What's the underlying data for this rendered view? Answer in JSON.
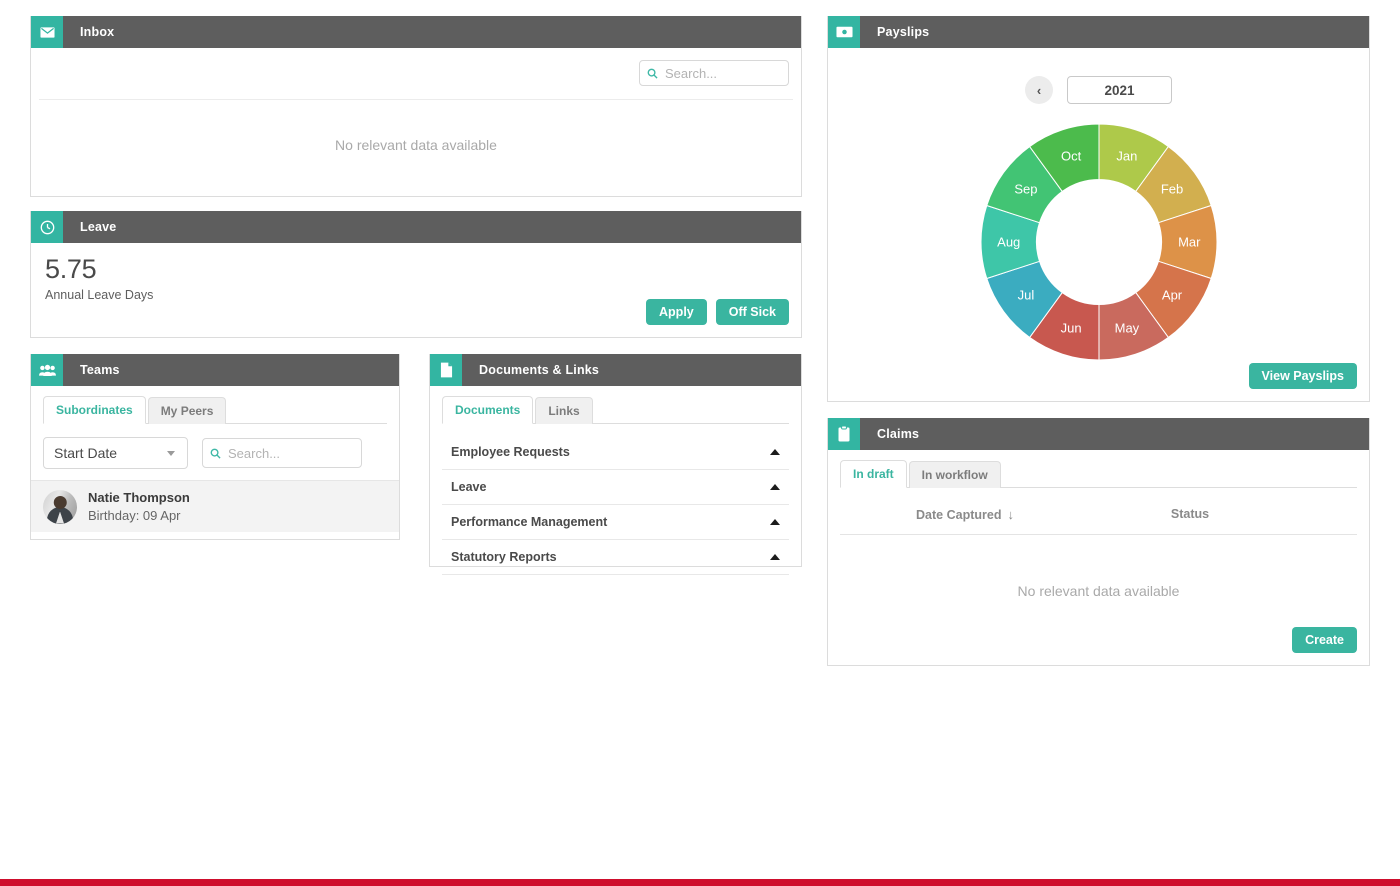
{
  "inbox": {
    "title": "Inbox",
    "icon": "envelope-icon",
    "search_placeholder": "Search...",
    "search_value": "",
    "empty_text": "No relevant data available"
  },
  "leave": {
    "title": "Leave",
    "icon": "clock-icon",
    "balance": "5.75",
    "balance_label": "Annual Leave Days",
    "apply_label": "Apply",
    "off_sick_label": "Off Sick"
  },
  "teams": {
    "title": "Teams",
    "icon": "people-icon",
    "tabs": [
      {
        "label": "Subordinates",
        "active": true
      },
      {
        "label": "My Peers",
        "active": false
      }
    ],
    "sort_value": "Start Date",
    "search_placeholder": "Search...",
    "search_value": "",
    "members": [
      {
        "name": "Natie Thompson",
        "detail": "Birthday: 09 Apr"
      }
    ]
  },
  "documents": {
    "title": "Documents & Links",
    "icon": "document-icon",
    "tabs": [
      {
        "label": "Documents",
        "active": true
      },
      {
        "label": "Links",
        "active": false
      }
    ],
    "categories": [
      {
        "label": "Employee Requests",
        "expanded": true
      },
      {
        "label": "Leave",
        "expanded": true
      },
      {
        "label": "Performance Management",
        "expanded": true
      },
      {
        "label": "Statutory Reports",
        "expanded": true
      }
    ]
  },
  "payslips": {
    "title": "Payslips",
    "icon": "money-icon",
    "prev_label": "‹",
    "year": "2021",
    "view_label": "View Payslips"
  },
  "claims": {
    "title": "Claims",
    "icon": "clipboard-icon",
    "tabs": [
      {
        "label": "In draft",
        "active": true
      },
      {
        "label": "In workflow",
        "active": false
      }
    ],
    "columns": [
      "Date Captured",
      "Status"
    ],
    "sort_indicator": "↓",
    "empty_text": "No relevant data available",
    "create_label": "Create",
    "rows": []
  },
  "chart_data": {
    "type": "pie",
    "title": "Payslips 2021",
    "subtitle": "",
    "variant": "donut",
    "inner_radius_ratio": 0.53,
    "start_angle_deg": 0,
    "categories": [
      "Jan",
      "Feb",
      "Mar",
      "Apr",
      "May",
      "Jun",
      "Jul",
      "Aug",
      "Sep",
      "Oct"
    ],
    "values": [
      1,
      1,
      1,
      1,
      1,
      1,
      1,
      1,
      1,
      1
    ],
    "slice_angle_deg": 36,
    "colors": [
      "#aec94a",
      "#d2af4f",
      "#dd9248",
      "#d5744b",
      "#c96a5e",
      "#c8584f",
      "#3bacc0",
      "#3ec6a8",
      "#42c474",
      "#4cbb4c"
    ],
    "label_color": "#ffffff",
    "legend": "none",
    "xlabel": "",
    "ylabel": ""
  },
  "theme": {
    "accent": "#3ab5a0",
    "header_bg": "#5e5e5e",
    "bottom_bar": "#ce0e2d"
  }
}
